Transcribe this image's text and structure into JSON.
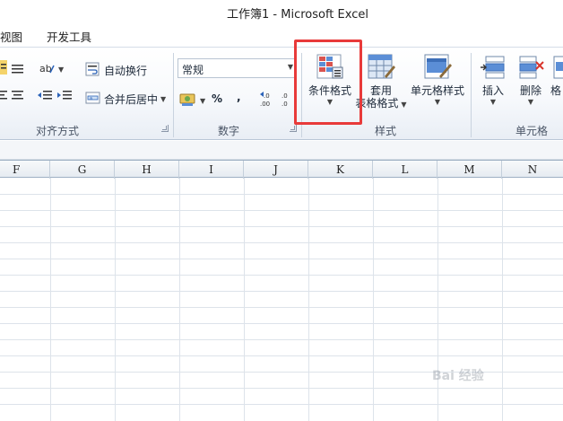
{
  "window": {
    "title": "工作簿1  -  Microsoft Excel"
  },
  "tabs": [
    "视图",
    "开发工具"
  ],
  "ribbon": {
    "alignment": {
      "wrap_text": "自动换行",
      "merge_center": "合并后居中",
      "group_label": "对齐方式"
    },
    "number": {
      "format_value": "常规",
      "percent": "%",
      "comma": ",",
      "inc_decimal": ".0",
      "dec_decimal": ".00",
      "group_label": "数字"
    },
    "styles": {
      "conditional_format": "条件格式",
      "format_as_table_line1": "套用",
      "format_as_table_line2": "表格格式",
      "cell_styles": "单元格样式",
      "group_label": "样式"
    },
    "cells": {
      "insert": "插入",
      "delete": "删除",
      "format_partial": "格",
      "group_label": "单元格"
    }
  },
  "columns": [
    "F",
    "G",
    "H",
    "I",
    "J",
    "K",
    "L",
    "M",
    "N"
  ],
  "watermark": "Bai 经验",
  "colors": {
    "highlight": "#e83a3a",
    "ribbon_bg": "#f7f9fc"
  }
}
